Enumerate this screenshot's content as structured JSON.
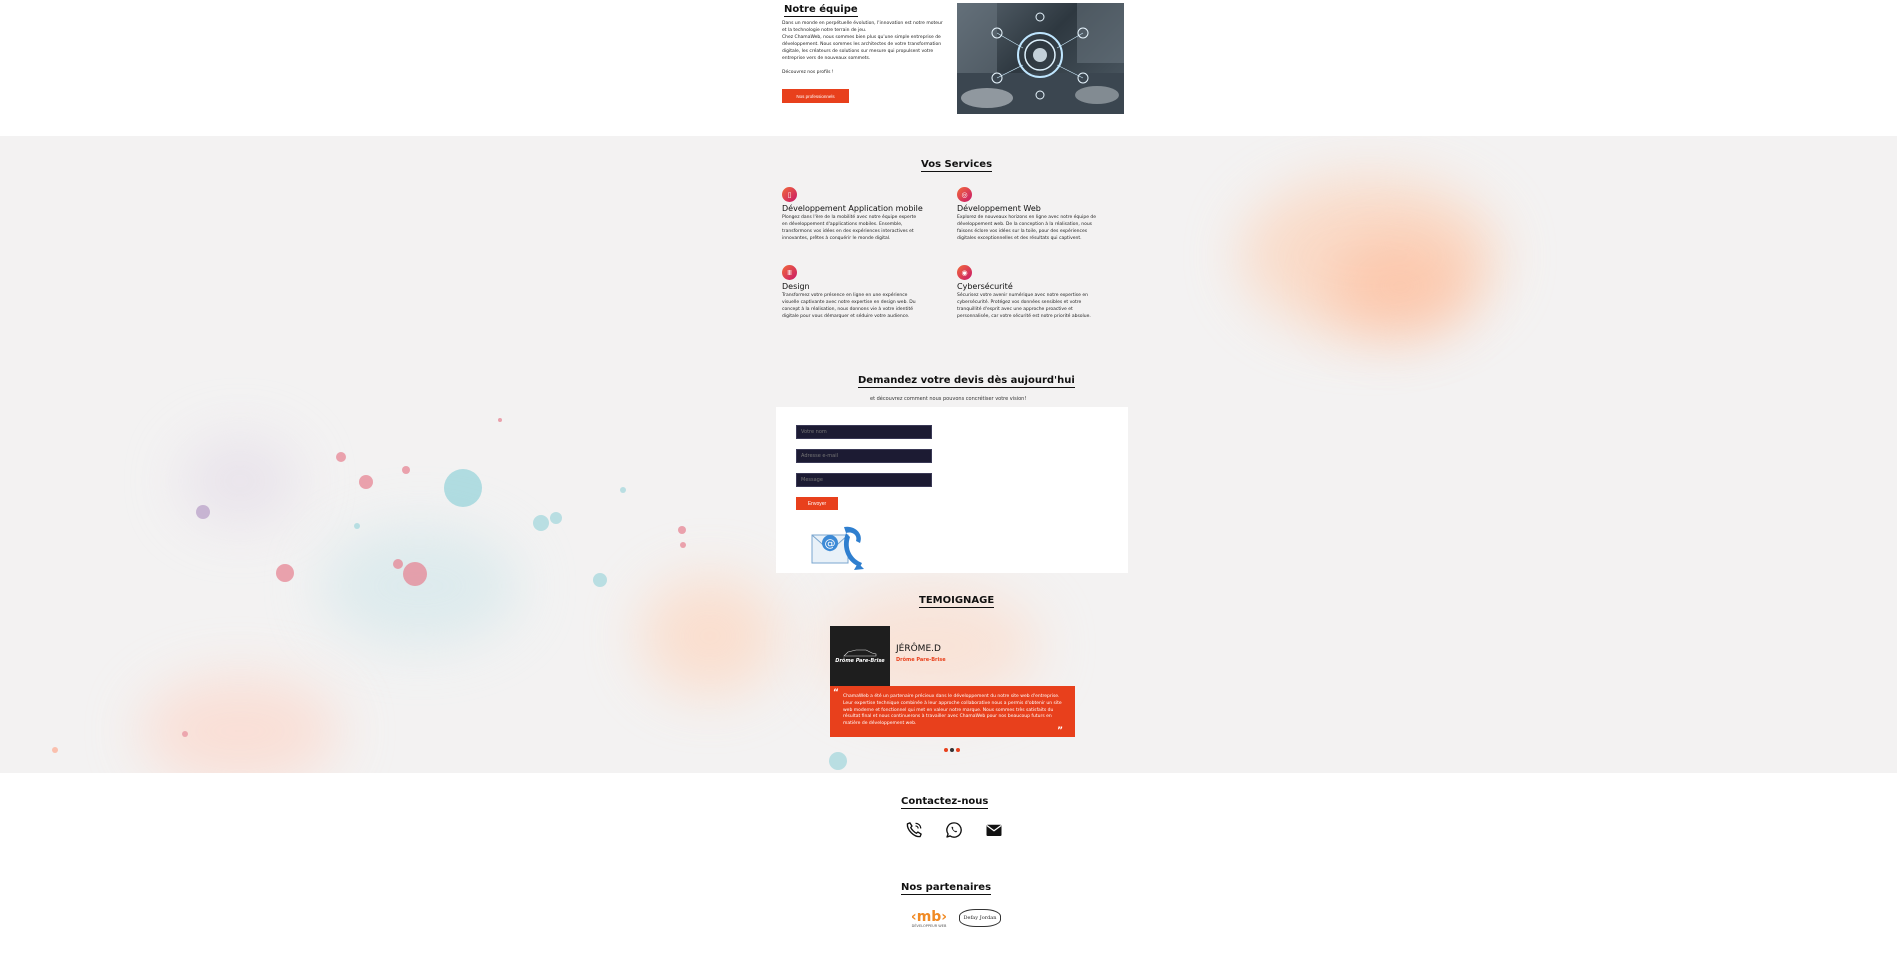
{
  "team": {
    "title": "Notre équipe",
    "text": "Dans un monde en perpétuelle évolution, l'innovation est notre moteur et la technologie notre terrain de jeu.\nChez ChamaWeb, nous sommes bien plus qu'une simple entreprise de développement. Nous sommes les architectes de votre transformation digitale, les créateurs de solutions sur mesure qui propulsent votre entreprise vers de nouveaux sommets.\n\nDécouvrez nos profils !",
    "button_label": "Nos professionnels"
  },
  "services": {
    "title": "Vos Services",
    "items": [
      {
        "icon": "mobile-icon",
        "title": "Développement Application mobile",
        "desc": "Plongez dans l'ère de la mobilité avec notre équipe experte en développement d'applications mobiles. Ensemble, transformons vos idées en des expériences interactives et innovantes, prêtes à conquérir le monde digital."
      },
      {
        "icon": "web-icon",
        "title": "Développement Web",
        "desc": "Explorez de nouveaux horizons en ligne avec notre équipe de développement web. De la conception à la réalisation, nous faisons éclore vos idées sur la toile, pour des expériences digitales exceptionnelles et des résultats qui captivent."
      },
      {
        "icon": "design-icon",
        "title": "Design",
        "desc": "Transformez votre présence en ligne en une expérience visuelle captivante avec notre expertise en design web. Du concept à la réalisation, nous donnons vie à votre identité digitale pour vous démarquer et séduire votre audience."
      },
      {
        "icon": "security-icon",
        "title": "Cybersécurité",
        "desc": "Sécurisez votre avenir numérique avec notre expertise en cybersécurité. Protégez vos données sensibles et votre tranquillité d'esprit avec une approche proactive et personnalisée, car votre sécurité est notre priorité absolue."
      }
    ]
  },
  "devis": {
    "title": "Demandez votre devis dès aujourd'hui",
    "subtitle": "et découvrez comment nous pouvons concrétiser votre vision!",
    "name_placeholder": "Votre nom",
    "email_placeholder": "Adresse e-mail",
    "message_placeholder": "Message",
    "submit_label": "Envoyer"
  },
  "testimonial": {
    "title": "TEMOIGNAGE",
    "logo_text": "Drôme Pare-Brise",
    "name": "JÉRÔME.D",
    "company": "Drôme Pare-Brise",
    "quote": "ChamaWeb a été un partenaire précieux dans le développement du notre site web d'entreprise. Leur expertise technique combinée à leur approche collaborative nous a permis d'obtenir un site web moderne et fonctionnel qui met en valeur notre marque. Nous sommes très satisfaits du résultat final et nous continuerons à travailler avec ChamaWeb pour nos beaucoup futurs en matière de développement web.",
    "slide_count": 3,
    "active_slide": 2
  },
  "contact": {
    "title": "Contactez-nous",
    "icons": [
      "phone-icon",
      "whatsapp-icon",
      "email-icon"
    ]
  },
  "partners": {
    "title": "Nos partenaires",
    "logos": [
      {
        "name": "partner-mb-logo",
        "text": "DÉVELOPPEUR WEB"
      },
      {
        "name": "partner-defay-logo",
        "text": "Defay Jordan"
      }
    ]
  },
  "colors": {
    "accent": "#e8401c",
    "input_bg": "#1c1b33"
  }
}
